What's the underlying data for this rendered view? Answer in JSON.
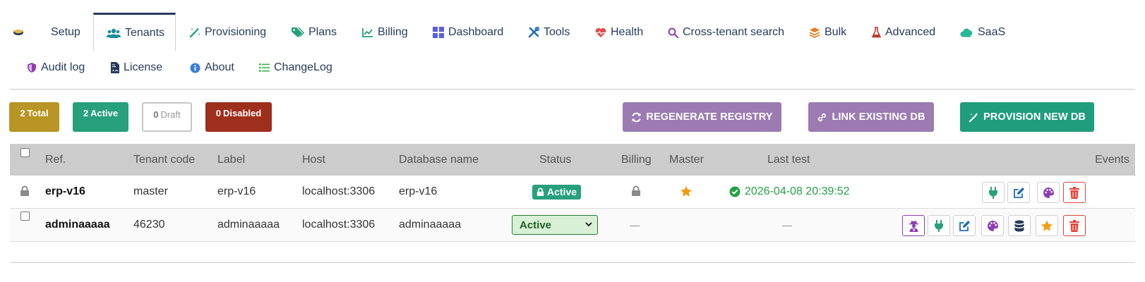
{
  "tabs": {
    "row1": [
      {
        "label": "",
        "icon": "database-small-icon"
      },
      {
        "label": "Setup",
        "icon": ""
      },
      {
        "label": "Tenants",
        "icon": "users-icon",
        "active": true
      },
      {
        "label": "Provisioning",
        "icon": "magic-wand-icon"
      },
      {
        "label": "Plans",
        "icon": "tags-icon"
      },
      {
        "label": "Billing",
        "icon": "line-chart-icon"
      },
      {
        "label": "Dashboard",
        "icon": "grid-icon"
      },
      {
        "label": "Tools",
        "icon": "tools-icon"
      },
      {
        "label": "Health",
        "icon": "heartbeat-icon"
      },
      {
        "label": "Cross-tenant search",
        "icon": "search-icon"
      },
      {
        "label": "Bulk",
        "icon": "layers-icon"
      },
      {
        "label": "Advanced",
        "icon": "flask-icon"
      },
      {
        "label": "SaaS",
        "icon": "cloud-icon"
      }
    ],
    "row2": [
      {
        "label": "Audit log",
        "icon": "shield-icon"
      },
      {
        "label": "License",
        "icon": "file-contract-icon"
      },
      {
        "label": "About",
        "icon": "info-icon"
      },
      {
        "label": "ChangeLog",
        "icon": "list-icon"
      }
    ]
  },
  "badges": {
    "total": {
      "count": "2",
      "label": "Total",
      "color": "#b89524"
    },
    "active": {
      "count": "2",
      "label": "Active",
      "color": "#27a07c"
    },
    "draft": {
      "count": "0",
      "label": "Draft",
      "color": "#ffffff"
    },
    "disabled": {
      "count": "0",
      "label": "Disabled",
      "color": "#9e2f1c"
    }
  },
  "actions": {
    "regenerate": {
      "label": "REGENERATE REGISTRY",
      "color": "#9b7bb2",
      "icon": "sync-icon"
    },
    "link": {
      "label": "LINK EXISTING DB",
      "color": "#9b7bb2",
      "icon": "link-icon"
    },
    "provision": {
      "label": "PROVISION NEW DB",
      "color": "#1f9d7c",
      "icon": "magic-wand-icon"
    }
  },
  "table": {
    "headers": {
      "ref": "Ref.",
      "tenant_code": "Tenant code",
      "label": "Label",
      "host": "Host",
      "database": "Database name",
      "status": "Status",
      "billing": "Billing",
      "master": "Master",
      "last_test": "Last test",
      "events": "Events"
    },
    "rows": [
      {
        "ref": "erp-v16",
        "tenant_code": "master",
        "label": "erp-v16",
        "host": "localhost:3306",
        "database": "erp-v16",
        "status": "Active",
        "billing_icon": "lock-icon",
        "master_icon": "star-icon",
        "last_test": "2026-04-08 20:39:52",
        "events": [
          "plug-icon",
          "edit-icon",
          "palette-icon",
          "trash-icon"
        ]
      },
      {
        "ref": "adminaaaaa",
        "tenant_code": "46230",
        "label": "adminaaaaa",
        "host": "localhost:3306",
        "database": "adminaaaaa",
        "status": "Active",
        "billing": "—",
        "last_test": "—",
        "events": [
          "user-secret-icon",
          "plug-icon",
          "edit-icon",
          "palette-icon",
          "database-icon",
          "star-icon",
          "trash-icon"
        ]
      }
    ]
  },
  "colors": {
    "nav_text": "#263c5c",
    "header_bg": "#cccccc",
    "success": "#27a044",
    "star": "#f39c12",
    "danger": "#e04434"
  }
}
